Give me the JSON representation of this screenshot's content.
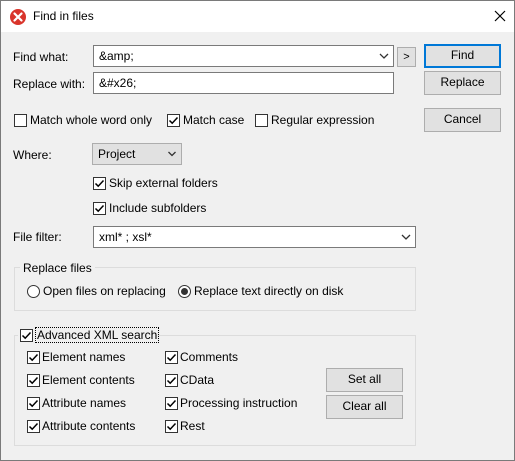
{
  "window": {
    "title": "Find in files"
  },
  "icons": {
    "app": "app-logo-icon",
    "close": "close-icon",
    "dropdown": "chevron-down-icon",
    "expand": "chevron-right-icon",
    "check": "checkmark-icon"
  },
  "find": {
    "label": "Find what:",
    "value": "&amp;",
    "expand_label": ">"
  },
  "replace": {
    "label": "Replace with:",
    "value": "&#x26;"
  },
  "buttons": {
    "find": "Find",
    "replace": "Replace",
    "cancel": "Cancel",
    "set_all": "Set all",
    "clear_all": "Clear all"
  },
  "options": {
    "match_whole_word": {
      "label": "Match whole word only",
      "checked": false
    },
    "match_case": {
      "label": "Match case",
      "checked": true
    },
    "regex": {
      "label": "Regular expression",
      "checked": false
    }
  },
  "where": {
    "label": "Where:",
    "selected": "Project",
    "skip_external": {
      "label": "Skip external folders",
      "checked": true
    },
    "include_subfolders": {
      "label": "Include subfolders",
      "checked": true
    }
  },
  "file_filter": {
    "label": "File filter:",
    "value": "xml* ; xsl*"
  },
  "replace_files": {
    "title": "Replace files",
    "open_on_replacing": {
      "label": "Open files on replacing",
      "selected": false
    },
    "replace_directly": {
      "label": "Replace text directly on disk",
      "selected": true
    }
  },
  "advanced": {
    "title": "Advanced XML search",
    "checked": true,
    "element_names": {
      "label": "Element names",
      "checked": true
    },
    "element_contents": {
      "label": "Element contents",
      "checked": true
    },
    "attribute_names": {
      "label": "Attribute names",
      "checked": true
    },
    "attribute_contents": {
      "label": "Attribute contents",
      "checked": true
    },
    "comments": {
      "label": "Comments",
      "checked": true
    },
    "cdata": {
      "label": "CData",
      "checked": true
    },
    "processing_instruction": {
      "label": "Processing instruction",
      "checked": true
    },
    "rest": {
      "label": "Rest",
      "checked": true
    }
  }
}
